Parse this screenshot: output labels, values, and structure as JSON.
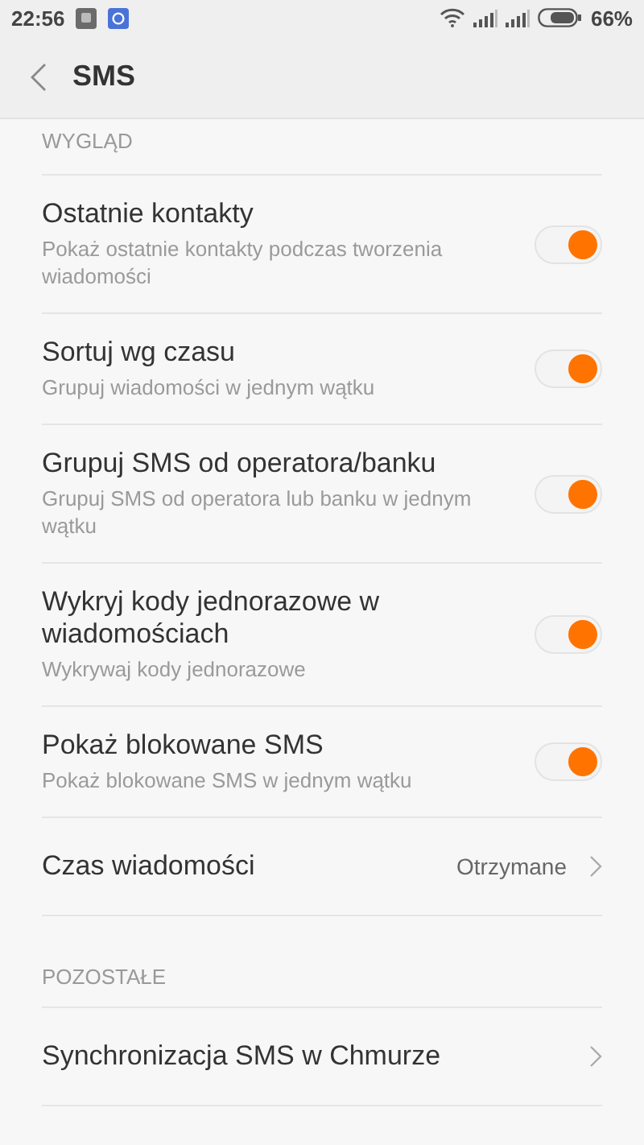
{
  "status_bar": {
    "time": "22:56",
    "battery": "66%"
  },
  "header": {
    "title": "SMS"
  },
  "sections": [
    {
      "title": "WYGLĄD",
      "items": [
        {
          "kind": "toggle",
          "title": "Ostatnie kontakty",
          "subtitle": "Pokaż ostatnie kontakty podczas tworzenia wiadomości",
          "on": true
        },
        {
          "kind": "toggle",
          "title": "Sortuj wg czasu",
          "subtitle": "Grupuj wiadomości w jednym wątku",
          "on": true
        },
        {
          "kind": "toggle",
          "title": "Grupuj SMS od operatora/banku",
          "subtitle": "Grupuj SMS od operatora lub banku w jednym wątku",
          "on": true
        },
        {
          "kind": "toggle",
          "title": "Wykryj kody jednorazowe w wiadomościach",
          "subtitle": "Wykrywaj kody jednorazowe",
          "on": true
        },
        {
          "kind": "toggle",
          "title": "Pokaż blokowane SMS",
          "subtitle": "Pokaż blokowane SMS w jednym wątku",
          "on": true
        },
        {
          "kind": "link",
          "title": "Czas wiadomości",
          "value": "Otrzymane"
        }
      ]
    },
    {
      "title": "POZOSTAŁE",
      "items": [
        {
          "kind": "link",
          "title": "Synchronizacja SMS w Chmurze"
        }
      ]
    }
  ]
}
